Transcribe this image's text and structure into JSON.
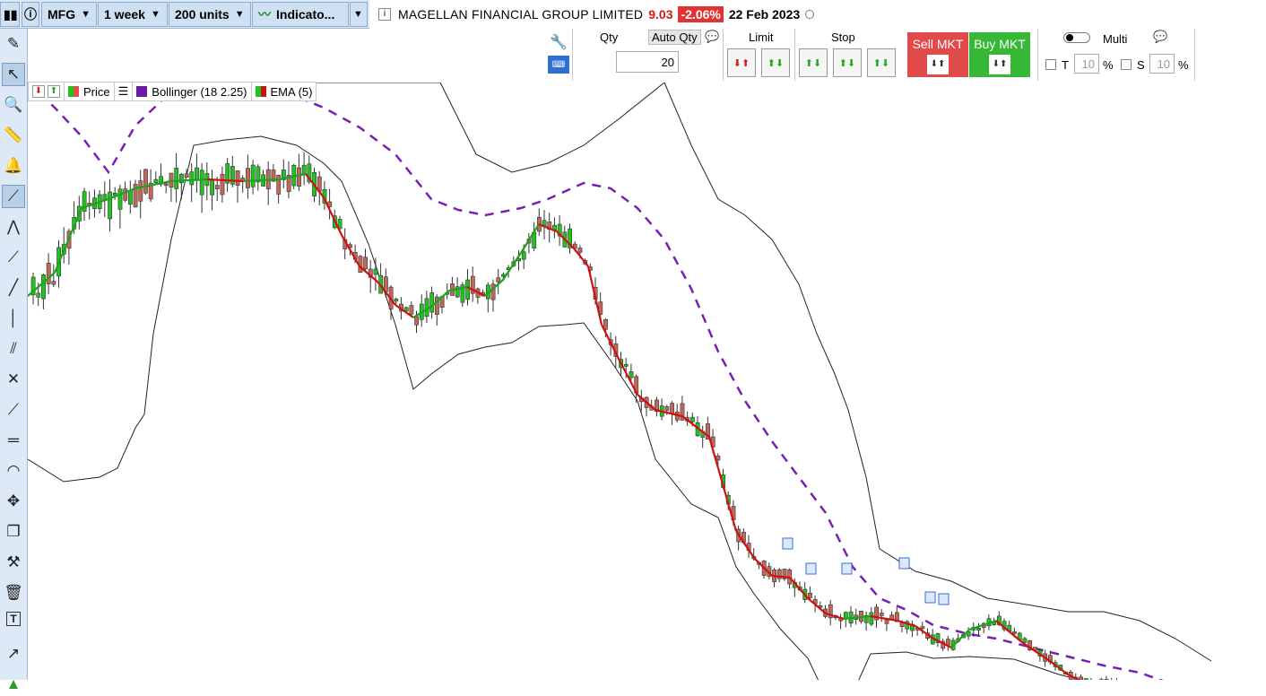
{
  "toolbar": {
    "symbol": "MFG",
    "period": "1 week",
    "units": "200 units",
    "indicators": "Indicato..."
  },
  "quote": {
    "name": "MAGELLAN FINANCIAL GROUP LIMITED",
    "price": "9.03",
    "change": "-2.06%",
    "date": "22 Feb 2023"
  },
  "order": {
    "qty_label": "Qty",
    "auto_qty_label": "Auto Qty",
    "qty_value": "20",
    "limit_label": "Limit",
    "stop_label": "Stop",
    "sell_label": "Sell MKT",
    "buy_label": "Buy MKT",
    "multi_label": "Multi",
    "t_label": "T",
    "t_value": "10",
    "t_unit": "%",
    "s_label": "S",
    "s_value": "10",
    "s_unit": "%"
  },
  "legend": {
    "price": "Price",
    "bollinger": "Bollinger (18 2.25)",
    "ema": "EMA (5)"
  },
  "colors": {
    "up": "#22c222",
    "down": "#c0695a",
    "ema_up": "#1aa51a",
    "ema_down": "#d01010",
    "mid_band": "#7a1fb5",
    "bands": "#222222",
    "sell": "#e14a4a",
    "buy": "#35b835"
  },
  "left_tools": [
    "pencil-icon",
    "cursor-icon",
    "zoom-icon",
    "ruler-icon",
    "alarm-icon",
    "trend-tool-icon",
    "channel-icon",
    "segment-icon",
    "line-icon",
    "vertical-line-icon",
    "fib-fan-icon",
    "parallel-icon",
    "regression-icon",
    "horizontal-line-f-icon",
    "arc-f-icon",
    "move-icon",
    "copy-icon",
    "tools-icon",
    "trash-icon",
    "text-icon",
    "arrow-icon",
    "triangle-icon"
  ],
  "chart_data": {
    "type": "candlestick",
    "note_icons": 6,
    "ema_points": [
      [
        0,
        238
      ],
      [
        30,
        212
      ],
      [
        60,
        140
      ],
      [
        90,
        130
      ],
      [
        120,
        118
      ],
      [
        160,
        110
      ],
      [
        200,
        108
      ],
      [
        240,
        110
      ],
      [
        280,
        108
      ],
      [
        310,
        102
      ],
      [
        330,
        128
      ],
      [
        350,
        170
      ],
      [
        370,
        205
      ],
      [
        390,
        222
      ],
      [
        410,
        248
      ],
      [
        430,
        262
      ],
      [
        450,
        250
      ],
      [
        470,
        232
      ],
      [
        490,
        228
      ],
      [
        510,
        238
      ],
      [
        530,
        220
      ],
      [
        550,
        190
      ],
      [
        570,
        158
      ],
      [
        590,
        166
      ],
      [
        610,
        186
      ],
      [
        625,
        205
      ],
      [
        640,
        270
      ],
      [
        660,
        310
      ],
      [
        680,
        348
      ],
      [
        700,
        365
      ],
      [
        730,
        372
      ],
      [
        760,
        395
      ],
      [
        770,
        430
      ],
      [
        790,
        500
      ],
      [
        810,
        530
      ],
      [
        830,
        550
      ],
      [
        850,
        552
      ],
      [
        870,
        575
      ],
      [
        890,
        592
      ],
      [
        910,
        598
      ],
      [
        940,
        595
      ],
      [
        970,
        600
      ],
      [
        990,
        606
      ],
      [
        1010,
        620
      ],
      [
        1030,
        630
      ],
      [
        1050,
        610
      ],
      [
        1080,
        600
      ],
      [
        1110,
        625
      ],
      [
        1140,
        645
      ],
      [
        1160,
        660
      ],
      [
        1180,
        670
      ],
      [
        1210,
        672
      ],
      [
        1240,
        676
      ],
      [
        1280,
        680
      ],
      [
        1320,
        676
      ]
    ],
    "mid_points": [
      [
        0,
        0
      ],
      [
        30,
        28
      ],
      [
        60,
        60
      ],
      [
        90,
        100
      ],
      [
        120,
        48
      ],
      [
        160,
        10
      ],
      [
        200,
        0
      ],
      [
        280,
        8
      ],
      [
        330,
        28
      ],
      [
        370,
        50
      ],
      [
        410,
        80
      ],
      [
        450,
        130
      ],
      [
        480,
        142
      ],
      [
        510,
        148
      ],
      [
        550,
        140
      ],
      [
        580,
        130
      ],
      [
        620,
        112
      ],
      [
        650,
        118
      ],
      [
        680,
        140
      ],
      [
        710,
        175
      ],
      [
        740,
        230
      ],
      [
        770,
        300
      ],
      [
        800,
        355
      ],
      [
        830,
        400
      ],
      [
        860,
        440
      ],
      [
        890,
        480
      ],
      [
        920,
        540
      ],
      [
        950,
        575
      ],
      [
        980,
        588
      ],
      [
        1010,
        605
      ],
      [
        1050,
        615
      ],
      [
        1080,
        620
      ],
      [
        1120,
        630
      ],
      [
        1160,
        640
      ],
      [
        1200,
        650
      ],
      [
        1240,
        658
      ],
      [
        1280,
        672
      ],
      [
        1320,
        680
      ]
    ],
    "upper_points": [
      [
        0,
        0
      ],
      [
        100,
        0
      ],
      [
        150,
        0
      ],
      [
        180,
        0
      ],
      [
        460,
        0
      ],
      [
        500,
        80
      ],
      [
        540,
        100
      ],
      [
        580,
        90
      ],
      [
        620,
        70
      ],
      [
        660,
        40
      ],
      [
        710,
        0
      ],
      [
        740,
        70
      ],
      [
        770,
        130
      ],
      [
        800,
        148
      ],
      [
        830,
        175
      ],
      [
        860,
        225
      ],
      [
        880,
        280
      ],
      [
        900,
        325
      ],
      [
        915,
        365
      ],
      [
        935,
        440
      ],
      [
        950,
        520
      ],
      [
        990,
        545
      ],
      [
        1030,
        556
      ],
      [
        1070,
        575
      ],
      [
        1120,
        583
      ],
      [
        1160,
        590
      ],
      [
        1200,
        590
      ],
      [
        1240,
        600
      ],
      [
        1280,
        620
      ],
      [
        1320,
        645
      ]
    ],
    "lower_points": [
      [
        0,
        420
      ],
      [
        40,
        445
      ],
      [
        80,
        440
      ],
      [
        100,
        430
      ],
      [
        120,
        385
      ],
      [
        130,
        370
      ],
      [
        140,
        280
      ],
      [
        160,
        175
      ],
      [
        185,
        70
      ],
      [
        220,
        64
      ],
      [
        260,
        60
      ],
      [
        300,
        70
      ],
      [
        330,
        90
      ],
      [
        350,
        110
      ],
      [
        380,
        180
      ],
      [
        410,
        270
      ],
      [
        430,
        342
      ],
      [
        450,
        325
      ],
      [
        480,
        303
      ],
      [
        510,
        295
      ],
      [
        540,
        290
      ],
      [
        570,
        272
      ],
      [
        600,
        270
      ],
      [
        620,
        268
      ],
      [
        650,
        310
      ],
      [
        680,
        355
      ],
      [
        700,
        420
      ],
      [
        740,
        470
      ],
      [
        770,
        485
      ],
      [
        790,
        540
      ],
      [
        810,
        570
      ],
      [
        840,
        610
      ],
      [
        870,
        642
      ],
      [
        890,
        684
      ],
      [
        910,
        682
      ],
      [
        925,
        670
      ],
      [
        940,
        637
      ],
      [
        980,
        635
      ],
      [
        1010,
        642
      ],
      [
        1050,
        640
      ],
      [
        1100,
        643
      ],
      [
        1150,
        660
      ],
      [
        1190,
        670
      ],
      [
        1230,
        682
      ],
      [
        1270,
        690
      ],
      [
        1320,
        684
      ]
    ]
  }
}
